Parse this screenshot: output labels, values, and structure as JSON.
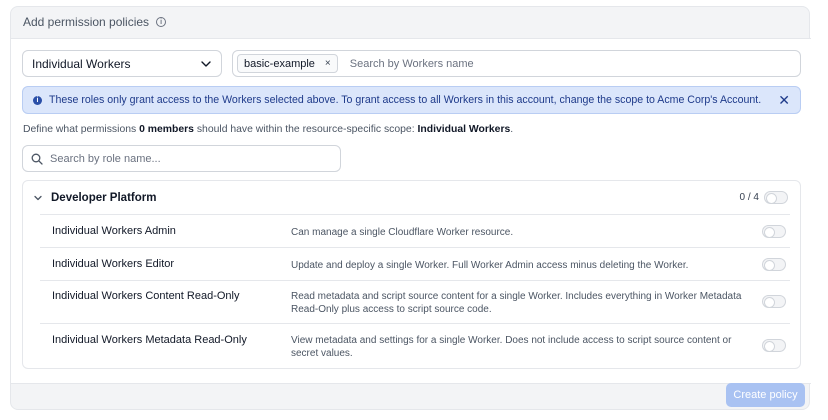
{
  "panel": {
    "title": "Add permission policies",
    "info_icon": "info-icon"
  },
  "scope": {
    "selected": "Individual Workers",
    "icon": "chevron-down-icon"
  },
  "workers": {
    "chip_label": "basic-example",
    "chip_remove": "×",
    "placeholder": "Search by Workers name"
  },
  "banner": {
    "text": "These roles only grant access to the Workers selected above. To grant access to all Workers in this account, change the scope to Acme Corp's Account.",
    "close": "✕",
    "icon": "info-filled-icon"
  },
  "define": {
    "prefix": "Define what permissions",
    "count": "0 members",
    "middle": "should have within the resource-specific scope:",
    "scope_name": "Individual Workers",
    "suffix": "."
  },
  "role_search": {
    "placeholder": "Search by role name...",
    "icon": "search-icon"
  },
  "group": {
    "title": "Developer Platform",
    "count": "0 / 4",
    "icon": "chevron-down-icon"
  },
  "roles": [
    {
      "name": "Individual Workers Admin",
      "description": "Can manage a single Cloudflare Worker resource.",
      "enabled": false
    },
    {
      "name": "Individual Workers Editor",
      "description": "Update and deploy a single Worker. Full Worker Admin access minus deleting the Worker.",
      "enabled": false
    },
    {
      "name": "Individual Workers Content Read-Only",
      "description": "Read metadata and script source content for a single Worker. Includes everything in Worker Metadata Read-Only plus access to script source code.",
      "enabled": false
    },
    {
      "name": "Individual Workers Metadata Read-Only",
      "description": "View metadata and settings for a single Worker. Does not include access to script source content or secret values.",
      "enabled": false
    }
  ],
  "actions": {
    "create_label": "Create policy"
  },
  "colors": {
    "accent": "#2a4fa8",
    "button_disabled": "#a9c2f2",
    "banner_bg": "#dbe6fb"
  }
}
